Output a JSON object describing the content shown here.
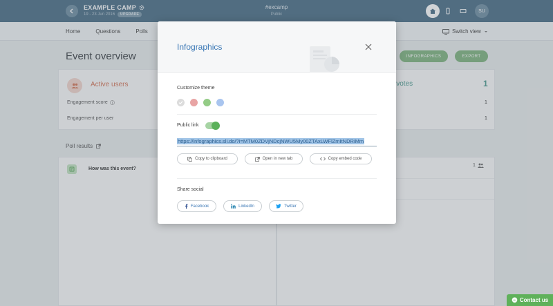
{
  "header": {
    "event_name": "EXAMPLE CAMP",
    "event_dates": "19 - 23 Jun 2016",
    "upgrade_label": "UPGRADE",
    "event_code": "#excamp",
    "visibility": "Public",
    "user_initials": "SU"
  },
  "nav": {
    "items": [
      "Home",
      "Questions",
      "Polls"
    ],
    "switch_view": "Switch view"
  },
  "page": {
    "title": "Event overview",
    "infographics_button": "INFOGRAPHICS",
    "export_button": "EXPORT"
  },
  "active_users": {
    "title": "Active users",
    "engagement_score_label": "Engagement score",
    "engagement_per_user_label": "Engagement per user"
  },
  "votes": {
    "title": "ll votes",
    "total": "1",
    "row1": "1",
    "row2": "1"
  },
  "polls": {
    "section_title": "Poll results",
    "question": "How was this event?",
    "count": "1"
  },
  "modal": {
    "title": "Infographics",
    "customize_label": "Customize theme",
    "public_link_label": "Public link",
    "public_link_enabled": true,
    "url": "https://infographics.sli.do/?i=MTM0ZDVjNDcjNWU5My00ZTAxLWFlZmItNDRiMm",
    "copy_button": "Copy to clipboard",
    "open_button": "Open in new tab",
    "embed_button": "Copy embed code",
    "share_label": "Share social",
    "social": [
      "Facebook",
      "LinkedIn",
      "Twitter"
    ],
    "theme_colors": [
      "#dcdcdc",
      "#e8a4a4",
      "#94cc86",
      "#a9c5ef"
    ]
  },
  "contact_label": "Contact us"
}
